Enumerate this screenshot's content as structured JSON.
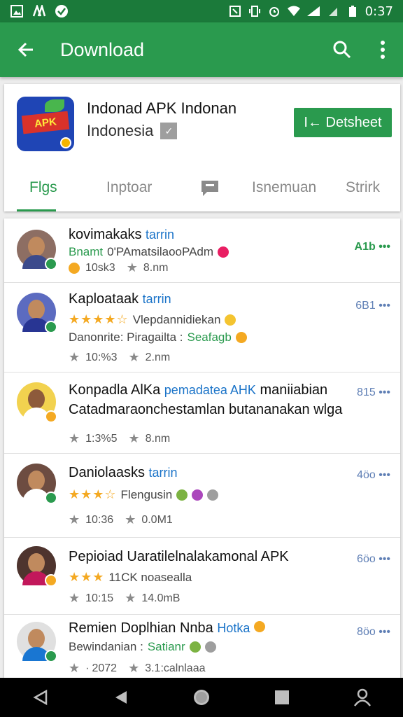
{
  "statusbar": {
    "time": "0:37"
  },
  "appbar": {
    "title": "Download"
  },
  "app": {
    "name": "Indonad APK Indonan",
    "developer": "Indonesia",
    "install_label": "I← Detsheet"
  },
  "tabs": [
    "Flgs",
    "Inptoar",
    "",
    "Isnemuan",
    "Strirk"
  ],
  "rows": [
    {
      "title": "kovimakaks",
      "accent": "tarrin",
      "line1_green": "Bnamt",
      "line1": "0'PAmatsilaooPAdm",
      "rating": "10sk3",
      "size": "8.nm",
      "count": "A1b •••",
      "count_green": true,
      "stars": ""
    },
    {
      "title": "Kaploataak",
      "accent": "tarrin",
      "line1": "Vlepdannidiekan",
      "line2_a": "Danonrite: Piragailta :",
      "line2_green": "Seafagb",
      "rating": "10:%3",
      "size": "2.nm",
      "count": "6B1 •••",
      "stars": "★★★★☆"
    },
    {
      "title": "Konpadla AlKa",
      "accent": "pemadatea AHK",
      "title_rest": "maniiabian",
      "line1": "Catadmaraonchestamlan butananakan wlga",
      "rating": "1:3%5",
      "size": "8.nm",
      "count": "815 •••",
      "stars": ""
    },
    {
      "title": "Daniolaasks",
      "accent": "tarrin",
      "line1": "Flengusin",
      "rating": "10:36",
      "size": "0.0M1",
      "count": "4öo •••",
      "stars": "★★★☆"
    },
    {
      "title": "Pepioiad Uaratilelnalakamonal APK",
      "accent": "",
      "line1": "11CK noasealla",
      "rating": "10:15",
      "size": "14.0mB",
      "count": "6öo •••",
      "stars": "★★★"
    },
    {
      "title": "Remien Doplhian Nnba",
      "accent": "Hotka",
      "line1_a": "Bewindanian :",
      "line1_green": "Satianr",
      "rating": "2072",
      "size": "3.1:calnlaaa",
      "count": "8öo •••",
      "stars": ""
    }
  ],
  "colors": {
    "primary": "#2a9a4e",
    "statusbar": "#1b7a3a",
    "accent_blue": "#1a73c8",
    "star": "#f4a922"
  }
}
